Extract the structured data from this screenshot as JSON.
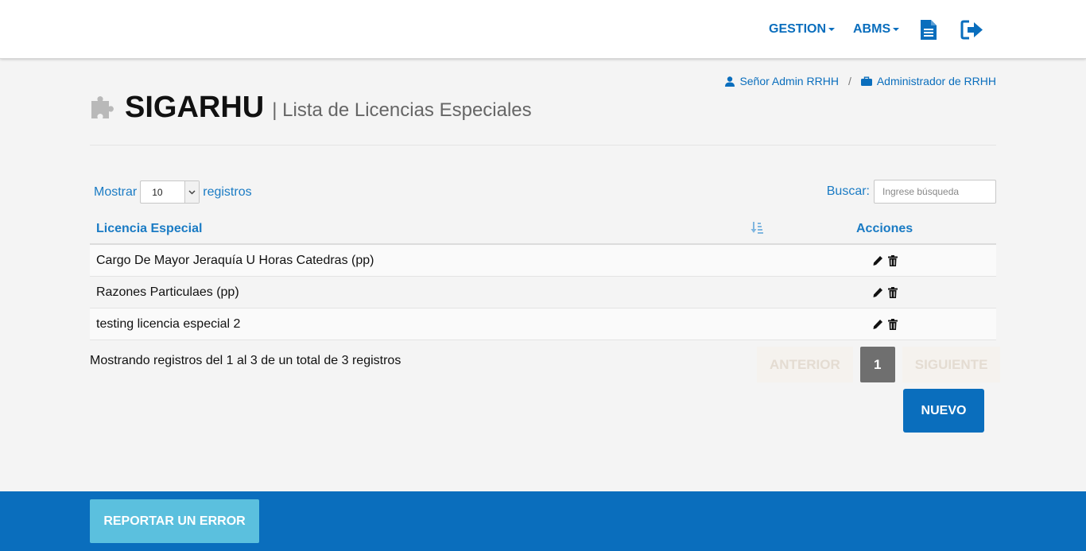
{
  "nav": {
    "gestion_label": "GESTION",
    "abms_label": "ABMS",
    "icons": [
      "document-icon",
      "logout-icon"
    ]
  },
  "user": {
    "name": "Señor Admin RRHH",
    "role": "Administrador de RRHH",
    "separator": "/"
  },
  "header": {
    "app_title": "SIGARHU",
    "subtitle": "| Lista de Licencias Especiales"
  },
  "controls": {
    "show_label": "Mostrar",
    "page_size": "10",
    "records_label": "registros",
    "search_label": "Buscar:",
    "search_placeholder": "Ingrese búsqueda"
  },
  "table": {
    "columns": [
      "Licencia Especial",
      "Acciones"
    ],
    "rows": [
      {
        "name": "Cargo De Mayor Jeraquía U Horas Catedras (pp)"
      },
      {
        "name": "Razones Particulaes (pp)"
      },
      {
        "name": "testing licencia especial 2"
      }
    ]
  },
  "footer_info": "Mostrando registros del 1 al 3 de un total de 3 registros",
  "pagination": {
    "prev_label": "ANTERIOR",
    "current_page": "1",
    "next_label": "SIGUIENTE"
  },
  "buttons": {
    "new_label": "NUEVO",
    "report_label": "REPORTAR UN ERROR"
  },
  "colors": {
    "primary": "#0a6ebd",
    "link": "#1a7bc4",
    "report_button": "#5bc0de",
    "page_active": "#6f6f6f"
  }
}
